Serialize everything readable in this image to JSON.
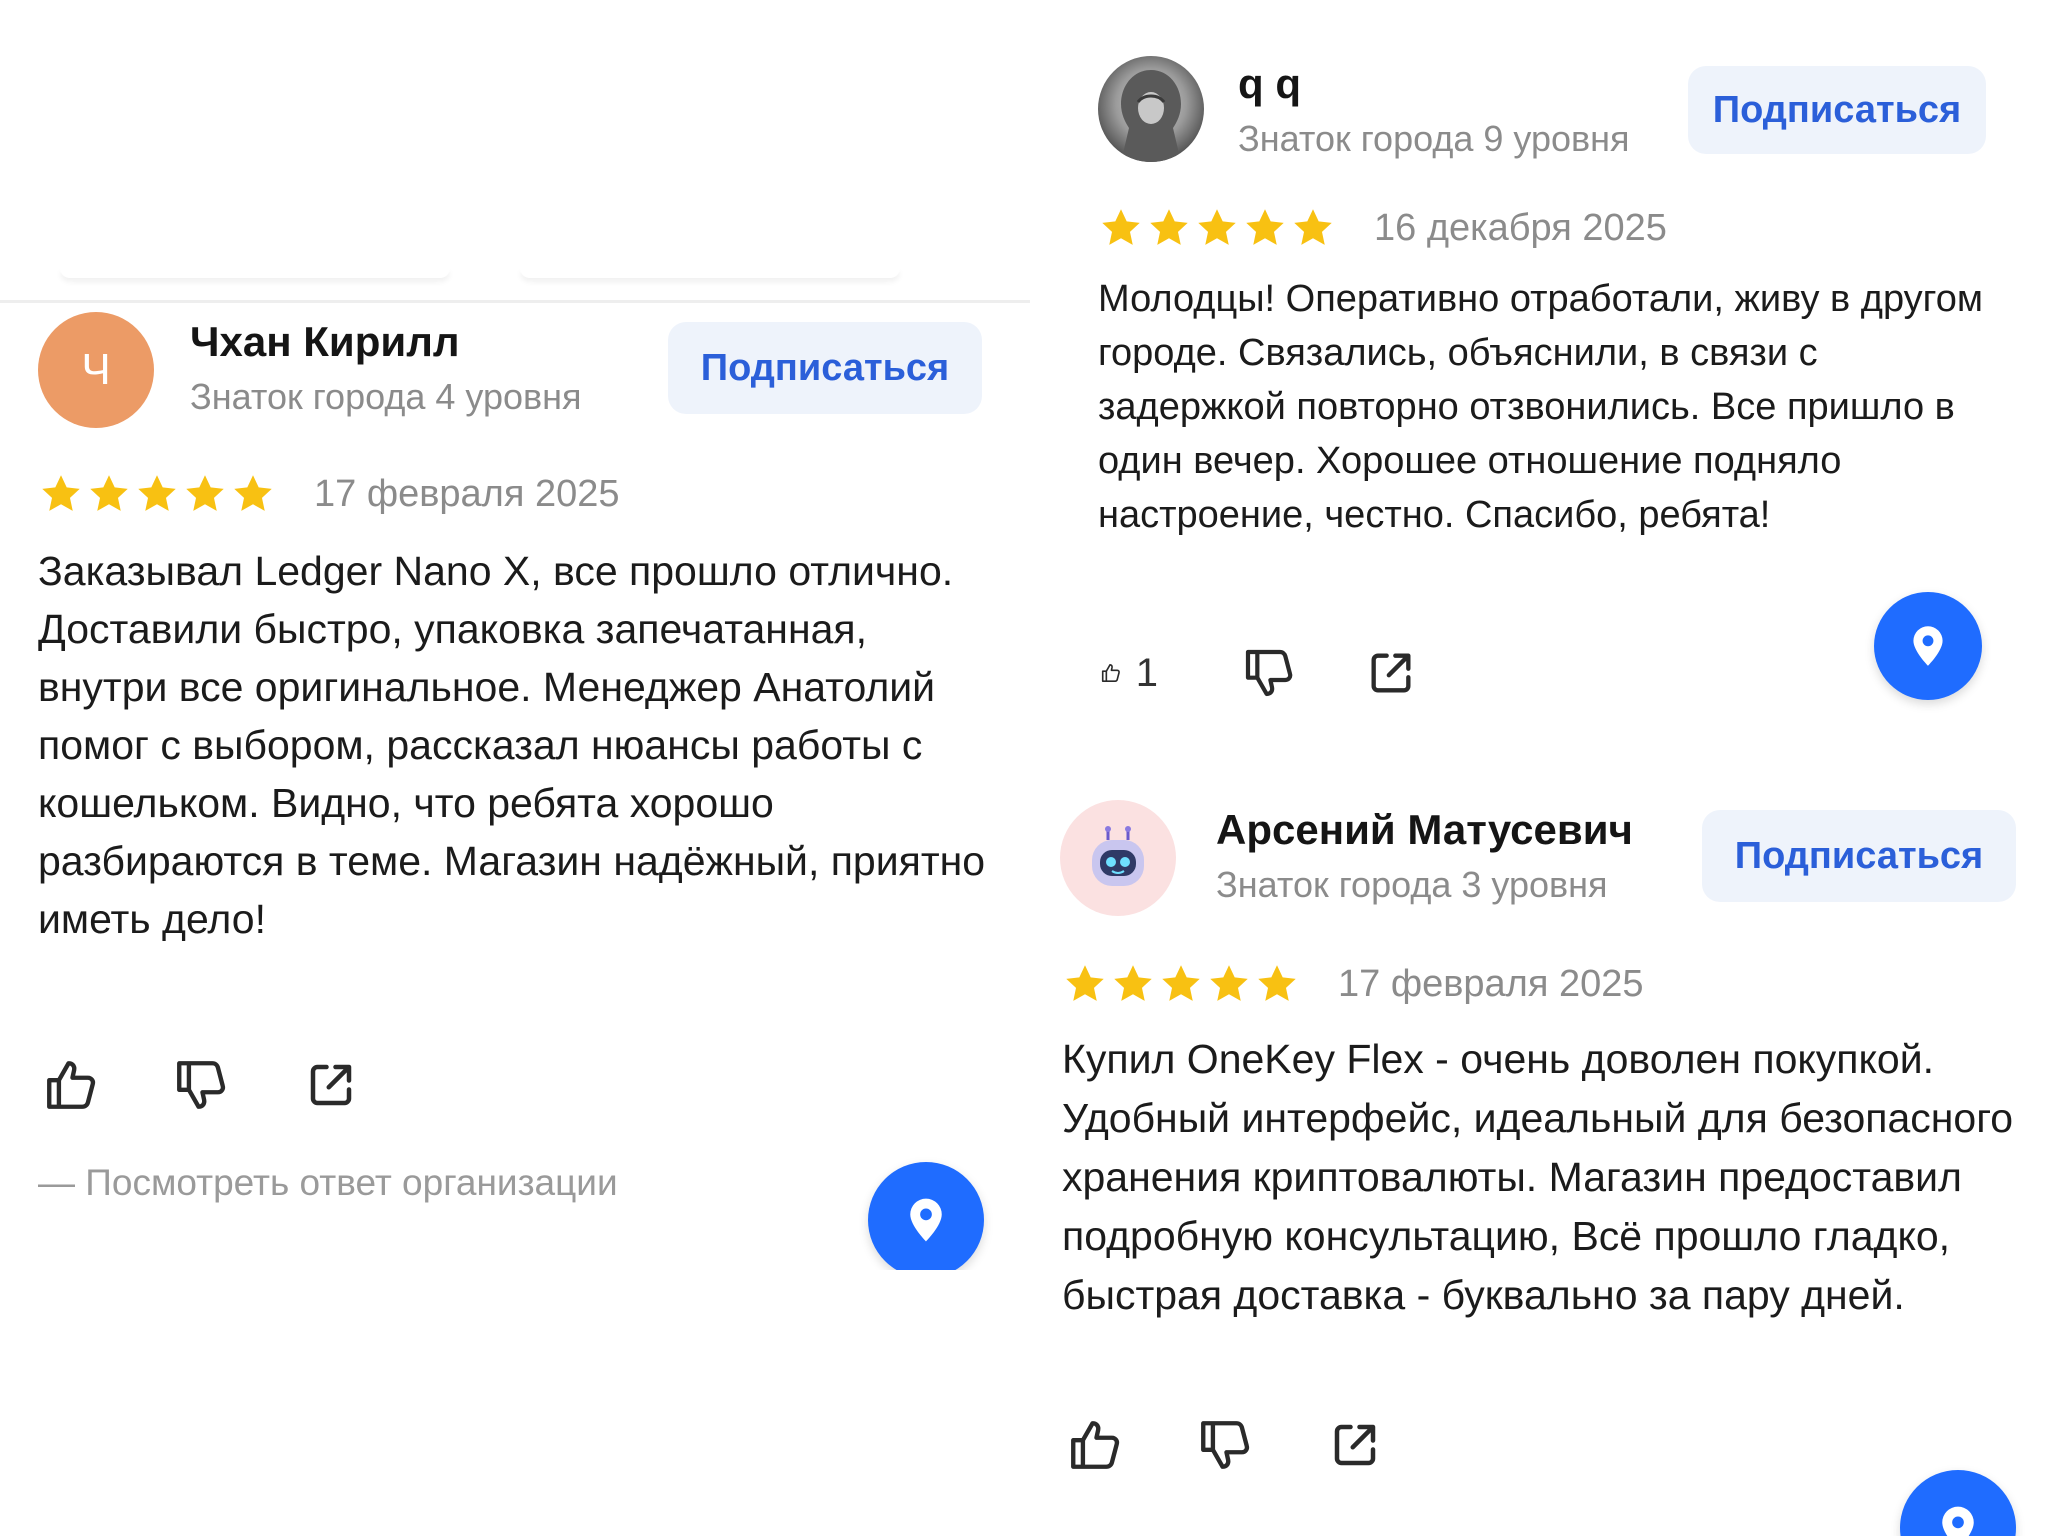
{
  "colors": {
    "accent": "#1f6cff",
    "star": "#f8c112",
    "subscribe_bg": "#eef3fb",
    "subscribe_text": "#2b5fd9",
    "muted_text": "#8b8b8b",
    "avatar_letter_bg": "#ec9b66"
  },
  "reviews": [
    {
      "author": "Чхан Кирилл",
      "avatar_letter": "Ч",
      "level": "Знаток города 4 уровня",
      "subscribe_label": "Подписаться",
      "rating": 5,
      "date": "17 февраля 2025",
      "text": "Заказывал Ledger Nano X, все прошло отлично. Доставили быстро, упаковка запечатанная, внутри все оригинальное. Менеджер Анатолий помог с выбором, рассказал нюансы работы с кошельком. Видно, что ребята хорошо разбираются в теме. Магазин надёжный, приятно иметь дело!",
      "org_reply_label": "— Посмотреть ответ организации",
      "icons": [
        "like-icon",
        "dislike-icon",
        "share-icon"
      ]
    },
    {
      "author": "q q",
      "level": "Знаток города 9 уровня",
      "subscribe_label": "Подписаться",
      "rating": 5,
      "date": "16 декабря 2025",
      "text": "Молодцы! Оперативно отработали, живу в другом городе. Связались, объяснили, в связи с задержкой повторно отзвонились. Все пришло в один вечер. Хорошее отношение подняло настроение, честно. Спасибо, ребята!",
      "like_count": "1",
      "icons": [
        "like-icon",
        "dislike-icon",
        "share-icon"
      ]
    },
    {
      "author": "Арсений Матусевич",
      "level": "Знаток города 3 уровня",
      "subscribe_label": "Подписаться",
      "rating": 5,
      "date": "17 февраля 2025",
      "text": "Купил OneKey Flex - очень доволен покупкой. Удобный интерфейс, идеальный для безопасного хранения криптовалюты. Магазин предоставил подробную консультацию, Всё прошло гладко, быстрая доставка - буквально за пару дней.",
      "icons": [
        "like-icon",
        "dislike-icon",
        "share-icon"
      ]
    }
  ],
  "fab_icon": "map-pin-icon"
}
